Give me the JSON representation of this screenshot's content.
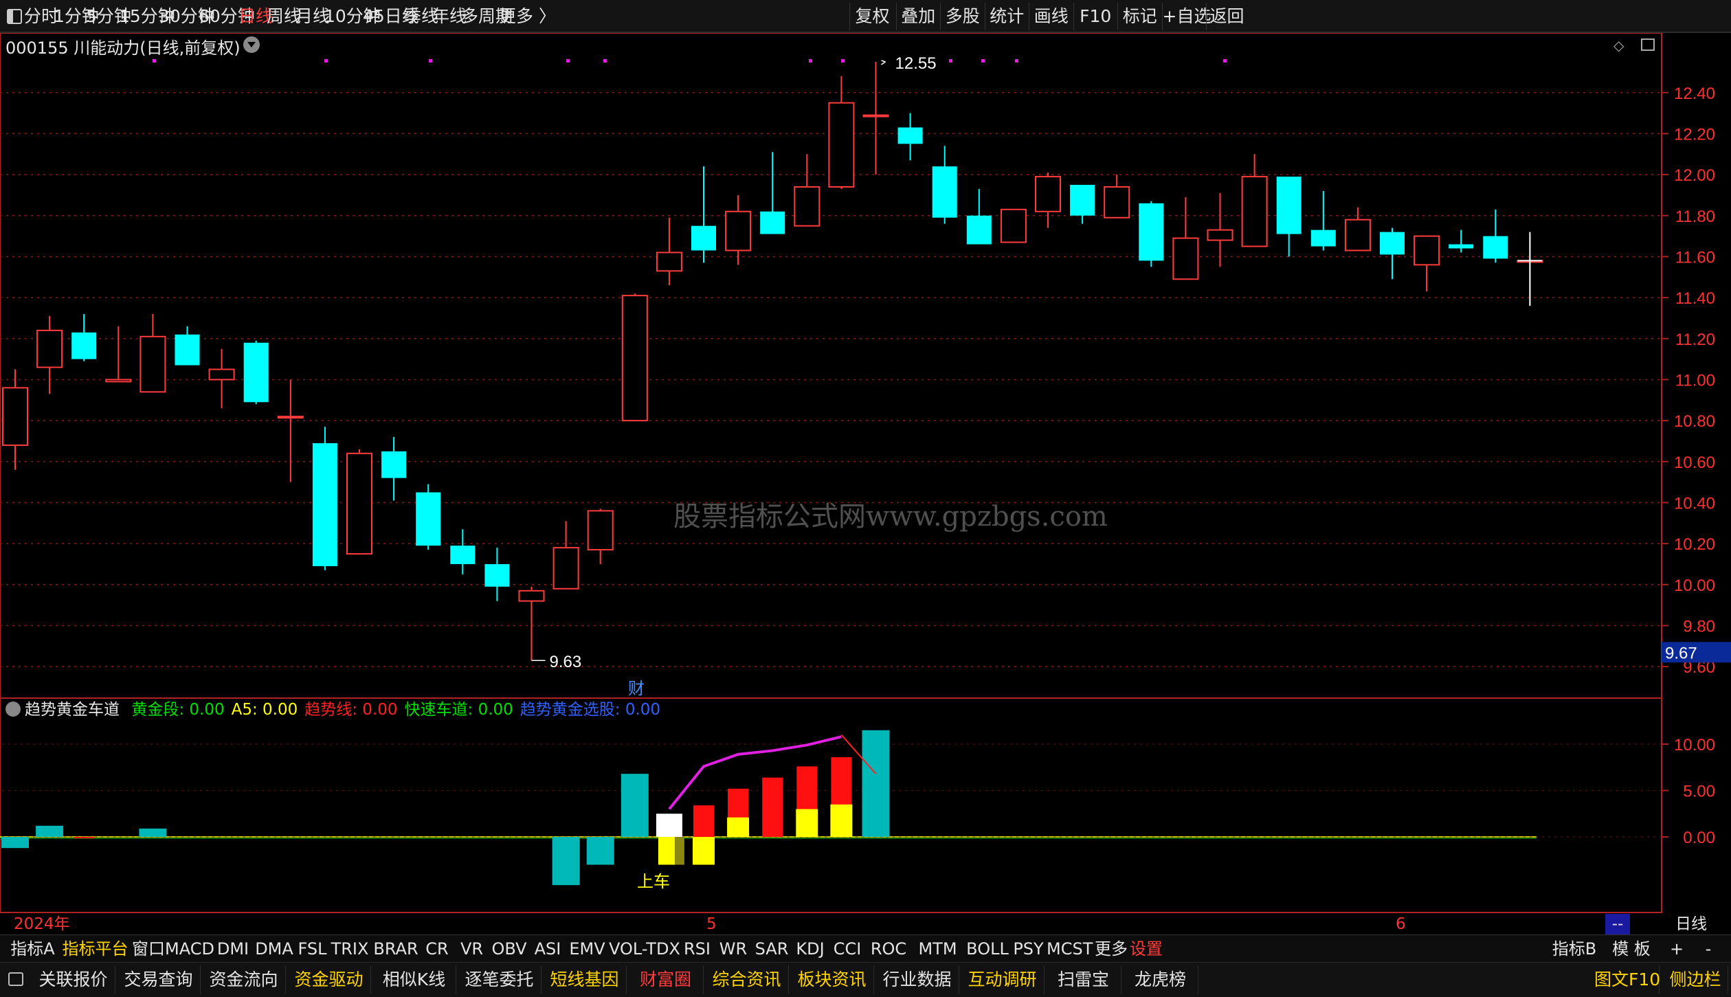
{
  "toolbar": {
    "timeframes": [
      "分时",
      "1分钟",
      "5分钟",
      "15分钟",
      "30分钟",
      "60分钟",
      "日线",
      "周线",
      "月线",
      "10分钟",
      "45日线",
      "季线",
      "年线",
      "多周期",
      "更多 〉"
    ],
    "active_timeframe": "日线",
    "right_buttons": [
      "复权",
      "叠加",
      "多股",
      "统计",
      "画线",
      "F10",
      "标记",
      "+自选",
      "返回"
    ]
  },
  "stock": {
    "code": "000155",
    "name": "川能动力",
    "mode": "(日线,前复权)"
  },
  "watermark": "股票指标公式网www.gpzbgs.com",
  "price_axis": {
    "ticks": [
      "12.40",
      "12.20",
      "12.00",
      "11.80",
      "11.60",
      "11.40",
      "11.20",
      "11.00",
      "10.80",
      "10.60",
      "10.40",
      "10.20",
      "10.00",
      "9.80",
      "9.60"
    ],
    "current_tag": "9.67"
  },
  "annotations": {
    "high_label": "12.55",
    "low_label": "9.63",
    "fin_label": "财",
    "entry_label": "上车"
  },
  "indicator": {
    "name": "趋势黄金车道",
    "fields": [
      {
        "label": "黄金段: 0.00",
        "color": "#00e000"
      },
      {
        "label": "A5: 0.00",
        "color": "#ffff00"
      },
      {
        "label": "趋势线: 0.00",
        "color": "#ff2020"
      },
      {
        "label": "快速车道: 0.00",
        "color": "#00e000"
      },
      {
        "label": "趋势黄金选股: 0.00",
        "color": "#3060ff"
      }
    ],
    "axis_ticks": [
      "10.00",
      "5.00",
      "0.00"
    ]
  },
  "xaxis": {
    "year_label": "2024年",
    "month_labels": [
      "5",
      "6"
    ],
    "period_label": "日线",
    "scroll_label": "--"
  },
  "indicator_tabs": [
    "指标A",
    "指标平台",
    "窗口",
    "MACD",
    "DMI",
    "DMA",
    "FSL",
    "TRIX",
    "BRAR",
    "CR",
    "VR",
    "OBV",
    "ASI",
    "EMV",
    "VOL-TDX",
    "RSI",
    "WR",
    "SAR",
    "KDJ",
    "CCI",
    "ROC",
    "MTM",
    "BOLL",
    "PSY",
    "MCST",
    "更多",
    "设置"
  ],
  "indicator_tabs_right": [
    "指标B",
    "模 板",
    "+",
    "-"
  ],
  "function_tabs": [
    "关联报价",
    "交易查询",
    "资金流向",
    "资金驱动",
    "相似K线",
    "逐笔委托",
    "短线基因",
    "财富圈",
    "综合资讯",
    "板块资讯",
    "行业数据",
    "互动调研",
    "扫雷宝",
    "龙虎榜"
  ],
  "function_tabs_right": [
    "图文F10",
    "侧边栏"
  ],
  "chart_data": {
    "type": "candlestick",
    "ylim": [
      9.5,
      12.55
    ],
    "candles": [
      {
        "o": 10.68,
        "h": 11.05,
        "l": 10.56,
        "c": 10.96
      },
      {
        "o": 11.06,
        "h": 11.31,
        "l": 10.93,
        "c": 11.24
      },
      {
        "o": 11.23,
        "h": 11.32,
        "l": 11.09,
        "c": 11.1
      },
      {
        "o": 10.99,
        "h": 11.26,
        "l": 10.99,
        "c": 11.0
      },
      {
        "o": 10.94,
        "h": 11.32,
        "l": 10.94,
        "c": 11.21
      },
      {
        "o": 11.22,
        "h": 11.26,
        "l": 11.07,
        "c": 11.07
      },
      {
        "o": 11.0,
        "h": 11.15,
        "l": 10.86,
        "c": 11.05
      },
      {
        "o": 11.18,
        "h": 11.19,
        "l": 10.88,
        "c": 10.89
      },
      {
        "o": 10.82,
        "h": 11.0,
        "l": 10.5,
        "c": 10.82
      },
      {
        "o": 10.69,
        "h": 10.77,
        "l": 10.07,
        "c": 10.09
      },
      {
        "o": 10.15,
        "h": 10.66,
        "l": 10.15,
        "c": 10.64
      },
      {
        "o": 10.65,
        "h": 10.72,
        "l": 10.41,
        "c": 10.52
      },
      {
        "o": 10.45,
        "h": 10.49,
        "l": 10.17,
        "c": 10.19
      },
      {
        "o": 10.19,
        "h": 10.27,
        "l": 10.05,
        "c": 10.1
      },
      {
        "o": 10.1,
        "h": 10.18,
        "l": 9.92,
        "c": 9.99
      },
      {
        "o": 9.92,
        "h": 9.99,
        "l": 9.63,
        "c": 9.97
      },
      {
        "o": 9.98,
        "h": 10.31,
        "l": 9.98,
        "c": 10.18
      },
      {
        "o": 10.17,
        "h": 10.37,
        "l": 10.1,
        "c": 10.36
      },
      {
        "o": 10.8,
        "h": 11.42,
        "l": 10.8,
        "c": 11.41
      },
      {
        "o": 11.53,
        "h": 11.79,
        "l": 11.46,
        "c": 11.62
      },
      {
        "o": 11.75,
        "h": 12.04,
        "l": 11.57,
        "c": 11.63
      },
      {
        "o": 11.63,
        "h": 11.9,
        "l": 11.56,
        "c": 11.82
      },
      {
        "o": 11.82,
        "h": 12.11,
        "l": 11.74,
        "c": 11.71
      },
      {
        "o": 11.75,
        "h": 12.1,
        "l": 11.75,
        "c": 11.94
      },
      {
        "o": 11.94,
        "h": 12.48,
        "l": 11.93,
        "c": 12.35
      },
      {
        "o": 12.29,
        "h": 12.55,
        "l": 12.0,
        "c": 12.29
      },
      {
        "o": 12.23,
        "h": 12.3,
        "l": 12.07,
        "c": 12.15
      },
      {
        "o": 12.04,
        "h": 12.14,
        "l": 11.76,
        "c": 11.79
      },
      {
        "o": 11.8,
        "h": 11.93,
        "l": 11.69,
        "c": 11.66
      },
      {
        "o": 11.67,
        "h": 11.82,
        "l": 11.67,
        "c": 11.83
      },
      {
        "o": 11.82,
        "h": 12.01,
        "l": 11.74,
        "c": 11.99
      },
      {
        "o": 11.95,
        "h": 11.95,
        "l": 11.76,
        "c": 11.8
      },
      {
        "o": 11.79,
        "h": 12.0,
        "l": 11.79,
        "c": 11.94
      },
      {
        "o": 11.86,
        "h": 11.87,
        "l": 11.55,
        "c": 11.58
      },
      {
        "o": 11.49,
        "h": 11.89,
        "l": 11.49,
        "c": 11.69
      },
      {
        "o": 11.68,
        "h": 11.91,
        "l": 11.55,
        "c": 11.73
      },
      {
        "o": 11.65,
        "h": 12.1,
        "l": 11.65,
        "c": 11.99
      },
      {
        "o": 11.99,
        "h": 11.99,
        "l": 11.6,
        "c": 11.71
      },
      {
        "o": 11.73,
        "h": 11.92,
        "l": 11.63,
        "c": 11.65
      },
      {
        "o": 11.63,
        "h": 11.84,
        "l": 11.63,
        "c": 11.78
      },
      {
        "o": 11.72,
        "h": 11.74,
        "l": 11.49,
        "c": 11.61
      },
      {
        "o": 11.56,
        "h": 11.7,
        "l": 11.43,
        "c": 11.7
      },
      {
        "o": 11.66,
        "h": 11.73,
        "l": 11.62,
        "c": 11.64
      },
      {
        "o": 11.7,
        "h": 11.83,
        "l": 11.57,
        "c": 11.59
      },
      {
        "o": 11.58,
        "h": 11.7,
        "l": 11.36,
        "c": 11.58
      }
    ],
    "indicator": {
      "ylim": [
        -5.2,
        11.5
      ],
      "cyan_bars": [
        {
          "i": 0,
          "v": -1.2
        },
        {
          "i": 1,
          "v": 1.2
        },
        {
          "i": 4,
          "v": 0.9
        },
        {
          "i": 16,
          "v": -5.2
        },
        {
          "i": 17,
          "v": -3.0
        },
        {
          "i": 18,
          "v": 6.8
        },
        {
          "i": 25,
          "v": 11.5
        }
      ],
      "red_bars": [
        {
          "i": 2,
          "v": -0.15
        },
        {
          "i": 20,
          "v": 3.4
        },
        {
          "i": 21,
          "v": 5.2
        },
        {
          "i": 22,
          "v": 6.4
        },
        {
          "i": 23,
          "v": 7.6
        },
        {
          "i": 24,
          "v": 8.6
        }
      ],
      "yellow_bars": [
        {
          "i": 19,
          "v": -3.0
        },
        {
          "i": 20,
          "v": -3.0
        },
        {
          "i": 21,
          "v": 2.1
        },
        {
          "i": 23,
          "v": 3.0
        },
        {
          "i": 24,
          "v": 3.5
        }
      ],
      "white_bars": [
        {
          "i": 19,
          "v": 2.5
        }
      ],
      "magenta_line": [
        {
          "i": 19,
          "v": 3.0
        },
        {
          "i": 20,
          "v": 7.6
        },
        {
          "i": 21,
          "v": 8.9
        },
        {
          "i": 22,
          "v": 9.3
        },
        {
          "i": 23,
          "v": 9.9
        },
        {
          "i": 24,
          "v": 10.8
        }
      ],
      "red_line": [
        {
          "i": 24,
          "v": 11.0
        },
        {
          "i": 25,
          "v": 6.8
        }
      ]
    }
  }
}
